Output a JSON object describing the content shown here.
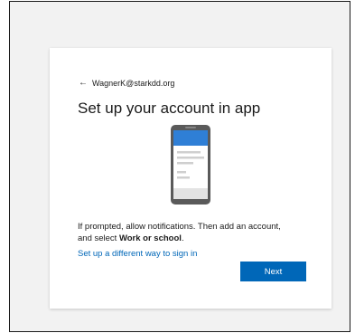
{
  "account": {
    "back_icon": "arrow-left-icon",
    "back_arrow_glyph": "←",
    "email": "WagnerK@starkdd.org"
  },
  "title": "Set up your account in app",
  "illustration": {
    "icon": "smartphone-illustration",
    "accent_color": "#2f7fd6"
  },
  "instructions": {
    "text_before": "If prompted, allow notifications. Then add an account, and select ",
    "bold": "Work or school",
    "text_after": "."
  },
  "alt_link": "Set up a different way to sign in",
  "next_button": "Next",
  "colors": {
    "primary": "#0067b8",
    "link": "#0067b8",
    "page_background": "#f2f2f2",
    "card_background": "#ffffff"
  }
}
